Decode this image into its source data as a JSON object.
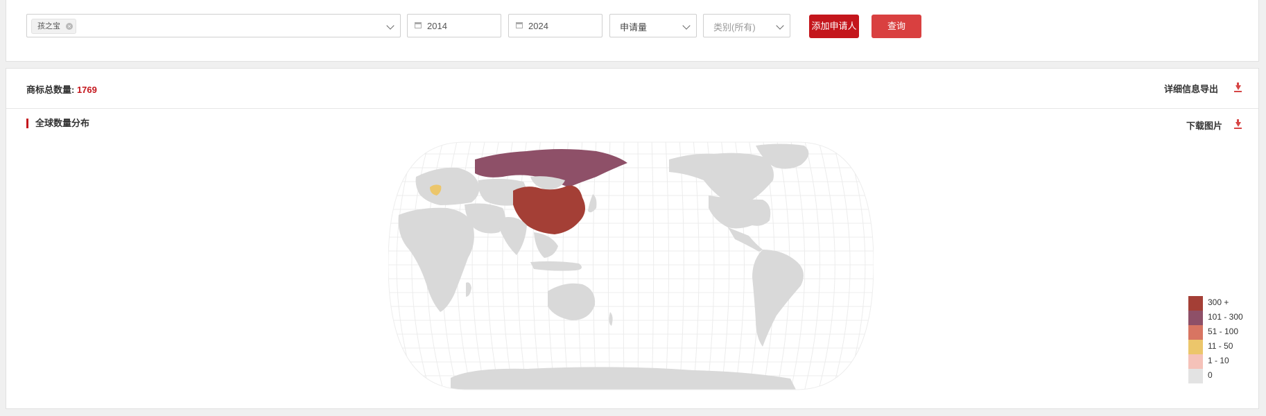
{
  "filters": {
    "applicant_tag": "孩之宝",
    "start_year": "2014",
    "end_year": "2024",
    "metric": "申请量",
    "category_placeholder": "类别(所有)",
    "add_button": "添加申请人",
    "query_button": "查询"
  },
  "summary": {
    "total_label": "商标总数量: ",
    "total_value": "1769",
    "export_label": "详细信息导出"
  },
  "map_section": {
    "title": "全球数量分布",
    "download_label": "下载图片"
  },
  "legend": [
    {
      "label": "300 +",
      "color": "#a43f36"
    },
    {
      "label": "101 - 300",
      "color": "#8e5068"
    },
    {
      "label": "51 - 100",
      "color": "#d87562"
    },
    {
      "label": "11 - 50",
      "color": "#ecc66b"
    },
    {
      "label": "1 - 10",
      "color": "#f5c2b9"
    },
    {
      "label": "0",
      "color": "#e3e3e3"
    }
  ],
  "map_regions": [
    {
      "region": "China",
      "bucket": "300 +"
    },
    {
      "region": "Russia",
      "bucket": "101 - 300"
    },
    {
      "region": "Switzerland",
      "bucket": "11 - 50"
    }
  ],
  "colors": {
    "accent": "#c4161c",
    "button_primary": "#c4161c",
    "button_secondary": "#d94040",
    "land_default": "#d9d9d9"
  }
}
